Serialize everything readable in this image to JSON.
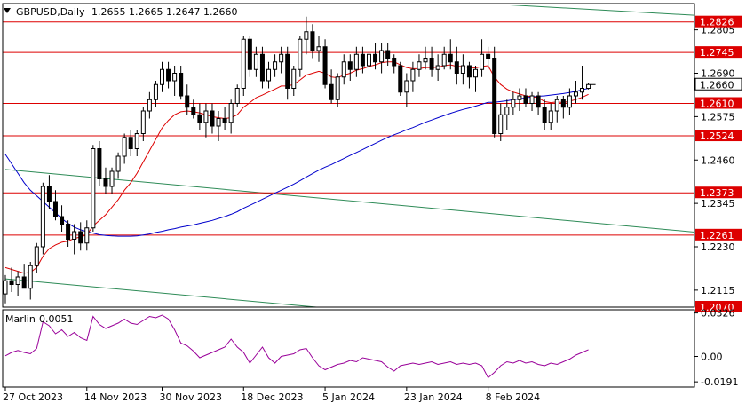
{
  "header": {
    "symbol": "GBPUSD,Daily",
    "open": "1.2655",
    "high": "1.2665",
    "low": "1.2647",
    "close": "1.2660"
  },
  "colors": {
    "background": "#ffffff",
    "candle_up_body": "#ffffff",
    "candle_down_body": "#000000",
    "candle_outline": "#000000",
    "ma_fast": "#dd0000",
    "ma_slow": "#0000cc",
    "trendline": "#2e8b57",
    "horizontal_level": "#dd0000",
    "marlin": "#990099",
    "axis": "#000000"
  },
  "chart_data": [
    {
      "type": "candlestick",
      "title": "GBPUSD,Daily 1.2655 1.2665 1.2647 1.2660",
      "ylim": [
        1.207,
        1.287
      ],
      "y_ticks": [
        "1.2805",
        "1.2690",
        "1.2575",
        "1.2460",
        "1.2345",
        "1.2230",
        "1.2115"
      ],
      "current_price": "1.2660",
      "levels": [
        {
          "value": 1.2826,
          "label": "1.2826"
        },
        {
          "value": 1.2745,
          "label": "1.2745"
        },
        {
          "value": 1.261,
          "label": "1.2610"
        },
        {
          "value": 1.2524,
          "label": "1.2524"
        },
        {
          "value": 1.2373,
          "label": "1.2373"
        },
        {
          "value": 1.2261,
          "label": "1.2261"
        },
        {
          "value": 1.207,
          "label": "1.2070"
        }
      ],
      "x_labels": [
        "27 Oct 2023",
        "14 Nov 2023",
        "30 Nov 2023",
        "18 Dec 2023",
        "5 Jan 2024",
        "23 Jan 2024",
        "8 Feb 2024"
      ],
      "trendlines": [
        {
          "name": "upper-descending-channel",
          "points": [
            [
              0,
              1.2946
            ],
            [
              129,
              1.2826
            ]
          ]
        },
        {
          "name": "middle-descending-line",
          "points": [
            [
              0,
              1.2435
            ],
            [
              129,
              1.224
            ]
          ]
        },
        {
          "name": "lower-descending-line",
          "points": [
            [
              0,
              1.2145
            ],
            [
              129,
              1.195
            ]
          ]
        }
      ],
      "candles": [
        [
          1.2105,
          1.2155,
          1.208,
          1.214
        ],
        [
          1.214,
          1.2175,
          1.211,
          1.213
        ],
        [
          1.213,
          1.2165,
          1.21,
          1.215
        ],
        [
          1.215,
          1.2185,
          1.2125,
          1.212
        ],
        [
          1.212,
          1.219,
          1.209,
          1.218
        ],
        [
          1.218,
          1.224,
          1.216,
          1.223
        ],
        [
          1.223,
          1.24,
          1.221,
          1.239
        ],
        [
          1.239,
          1.242,
          1.233,
          1.235
        ],
        [
          1.235,
          1.238,
          1.23,
          1.231
        ],
        [
          1.231,
          1.234,
          1.227,
          1.229
        ],
        [
          1.229,
          1.23,
          1.223,
          1.225
        ],
        [
          1.225,
          1.229,
          1.221,
          1.227
        ],
        [
          1.227,
          1.2295,
          1.222,
          1.224
        ],
        [
          1.224,
          1.23,
          1.222,
          1.228
        ],
        [
          1.228,
          1.25,
          1.227,
          1.249
        ],
        [
          1.249,
          1.251,
          1.239,
          1.241
        ],
        [
          1.241,
          1.244,
          1.237,
          1.239
        ],
        [
          1.239,
          1.244,
          1.237,
          1.243
        ],
        [
          1.243,
          1.248,
          1.241,
          1.247
        ],
        [
          1.247,
          1.253,
          1.245,
          1.252
        ],
        [
          1.252,
          1.254,
          1.247,
          1.249
        ],
        [
          1.249,
          1.254,
          1.247,
          1.253
        ],
        [
          1.253,
          1.26,
          1.251,
          1.259
        ],
        [
          1.259,
          1.264,
          1.257,
          1.262
        ],
        [
          1.262,
          1.267,
          1.26,
          1.266
        ],
        [
          1.266,
          1.272,
          1.264,
          1.27
        ],
        [
          1.27,
          1.272,
          1.265,
          1.267
        ],
        [
          1.267,
          1.271,
          1.263,
          1.269
        ],
        [
          1.269,
          1.271,
          1.262,
          1.263
        ],
        [
          1.263,
          1.266,
          1.258,
          1.26
        ],
        [
          1.26,
          1.262,
          1.257,
          1.258
        ],
        [
          1.258,
          1.261,
          1.254,
          1.256
        ],
        [
          1.256,
          1.261,
          1.252,
          1.259
        ],
        [
          1.259,
          1.261,
          1.253,
          1.255
        ],
        [
          1.255,
          1.259,
          1.251,
          1.257
        ],
        [
          1.257,
          1.26,
          1.254,
          1.256
        ],
        [
          1.256,
          1.262,
          1.253,
          1.261
        ],
        [
          1.261,
          1.266,
          1.26,
          1.265
        ],
        [
          1.265,
          1.279,
          1.263,
          1.278
        ],
        [
          1.278,
          1.279,
          1.268,
          1.27
        ],
        [
          1.27,
          1.276,
          1.268,
          1.274
        ],
        [
          1.274,
          1.276,
          1.265,
          1.267
        ],
        [
          1.267,
          1.272,
          1.265,
          1.27
        ],
        [
          1.27,
          1.274,
          1.268,
          1.272
        ],
        [
          1.272,
          1.276,
          1.269,
          1.274
        ],
        [
          1.274,
          1.276,
          1.262,
          1.265
        ],
        [
          1.265,
          1.271,
          1.263,
          1.27
        ],
        [
          1.27,
          1.279,
          1.268,
          1.278
        ],
        [
          1.278,
          1.284,
          1.274,
          1.28
        ],
        [
          1.28,
          1.282,
          1.273,
          1.275
        ],
        [
          1.275,
          1.279,
          1.272,
          1.276
        ],
        [
          1.276,
          1.278,
          1.265,
          1.266
        ],
        [
          1.266,
          1.27,
          1.261,
          1.262
        ],
        [
          1.262,
          1.269,
          1.26,
          1.268
        ],
        [
          1.268,
          1.274,
          1.266,
          1.272
        ],
        [
          1.272,
          1.274,
          1.267,
          1.27
        ],
        [
          1.27,
          1.276,
          1.268,
          1.274
        ],
        [
          1.274,
          1.276,
          1.269,
          1.271
        ],
        [
          1.271,
          1.275,
          1.27,
          1.274
        ],
        [
          1.274,
          1.277,
          1.27,
          1.272
        ],
        [
          1.272,
          1.277,
          1.269,
          1.275
        ],
        [
          1.275,
          1.277,
          1.271,
          1.273
        ],
        [
          1.273,
          1.274,
          1.269,
          1.271
        ],
        [
          1.271,
          1.272,
          1.263,
          1.264
        ],
        [
          1.264,
          1.269,
          1.26,
          1.267
        ],
        [
          1.267,
          1.272,
          1.264,
          1.27
        ],
        [
          1.27,
          1.274,
          1.268,
          1.272
        ],
        [
          1.272,
          1.276,
          1.27,
          1.273
        ],
        [
          1.273,
          1.276,
          1.268,
          1.27
        ],
        [
          1.27,
          1.274,
          1.267,
          1.271
        ],
        [
          1.271,
          1.276,
          1.27,
          1.274
        ],
        [
          1.274,
          1.278,
          1.27,
          1.272
        ],
        [
          1.272,
          1.276,
          1.266,
          1.269
        ],
        [
          1.269,
          1.274,
          1.266,
          1.271
        ],
        [
          1.271,
          1.272,
          1.265,
          1.268
        ],
        [
          1.268,
          1.271,
          1.264,
          1.27
        ],
        [
          1.27,
          1.278,
          1.268,
          1.274
        ],
        [
          1.274,
          1.276,
          1.27,
          1.273
        ],
        [
          1.273,
          1.276,
          1.252,
          1.253
        ],
        [
          1.253,
          1.261,
          1.251,
          1.258
        ],
        [
          1.258,
          1.262,
          1.254,
          1.26
        ],
        [
          1.26,
          1.264,
          1.258,
          1.262
        ],
        [
          1.262,
          1.265,
          1.259,
          1.263
        ],
        [
          1.263,
          1.265,
          1.26,
          1.261
        ],
        [
          1.261,
          1.264,
          1.259,
          1.263
        ],
        [
          1.263,
          1.264,
          1.258,
          1.26
        ],
        [
          1.26,
          1.262,
          1.254,
          1.256
        ],
        [
          1.256,
          1.261,
          1.254,
          1.259
        ],
        [
          1.259,
          1.263,
          1.256,
          1.262
        ],
        [
          1.262,
          1.263,
          1.257,
          1.26
        ],
        [
          1.26,
          1.265,
          1.258,
          1.263
        ],
        [
          1.263,
          1.267,
          1.261,
          1.264
        ],
        [
          1.264,
          1.271,
          1.262,
          1.265
        ],
        [
          1.265,
          1.2665,
          1.2647,
          1.266
        ]
      ],
      "ma_fast": [
        1.2175,
        1.217,
        1.2165,
        1.216,
        1.2162,
        1.2175,
        1.2205,
        1.2225,
        1.2235,
        1.2242,
        1.2245,
        1.2252,
        1.2256,
        1.2262,
        1.2285,
        1.23,
        1.2315,
        1.2335,
        1.2355,
        1.238,
        1.24,
        1.2425,
        1.2455,
        1.2485,
        1.2515,
        1.2545,
        1.2565,
        1.258,
        1.2588,
        1.259,
        1.2588,
        1.2585,
        1.258,
        1.2575,
        1.2572,
        1.257,
        1.2572,
        1.258,
        1.26,
        1.2612,
        1.2625,
        1.2632,
        1.264,
        1.2648,
        1.2656,
        1.2656,
        1.266,
        1.2672,
        1.2685,
        1.269,
        1.2695,
        1.269,
        1.268,
        1.2678,
        1.2685,
        1.269,
        1.2698,
        1.2702,
        1.2708,
        1.2712,
        1.2718,
        1.272,
        1.272,
        1.2712,
        1.2705,
        1.2702,
        1.2702,
        1.2705,
        1.2705,
        1.2706,
        1.271,
        1.2712,
        1.2708,
        1.2708,
        1.2705,
        1.2704,
        1.2708,
        1.271,
        1.268,
        1.266,
        1.2648,
        1.264,
        1.2635,
        1.263,
        1.2628,
        1.2625,
        1.2615,
        1.2612,
        1.2614,
        1.2612,
        1.2616,
        1.262,
        1.2626,
        1.2634
      ],
      "ma_slow": [
        1.2475,
        1.245,
        1.2425,
        1.24,
        1.238,
        1.2365,
        1.235,
        1.2335,
        1.232,
        1.2305,
        1.2292,
        1.2282,
        1.2275,
        1.227,
        1.2266,
        1.2262,
        1.226,
        1.2259,
        1.2258,
        1.2258,
        1.2258,
        1.2259,
        1.2261,
        1.2264,
        1.2268,
        1.2271,
        1.2275,
        1.2278,
        1.2282,
        1.2285,
        1.2288,
        1.2292,
        1.2296,
        1.23,
        1.2305,
        1.231,
        1.2316,
        1.2323,
        1.2332,
        1.234,
        1.2348,
        1.2356,
        1.2364,
        1.2372,
        1.238,
        1.2388,
        1.2396,
        1.2405,
        1.2415,
        1.2424,
        1.2433,
        1.2441,
        1.2448,
        1.2456,
        1.2464,
        1.2472,
        1.248,
        1.2488,
        1.2496,
        1.2504,
        1.2512,
        1.252,
        1.2527,
        1.2533,
        1.254,
        1.2546,
        1.2553,
        1.256,
        1.2566,
        1.2572,
        1.2578,
        1.2584,
        1.2589,
        1.2594,
        1.2598,
        1.2603,
        1.2608,
        1.2613,
        1.2613,
        1.2615,
        1.2617,
        1.262,
        1.2622,
        1.2625,
        1.2627,
        1.2629,
        1.263,
        1.2632,
        1.2634,
        1.2636,
        1.2639,
        1.2642,
        1.2646,
        1.265
      ]
    },
    {
      "type": "line",
      "title": "Marlin 0.0051",
      "name": "Marlin",
      "value_label": "0.0051",
      "ylim": [
        -0.023,
        0.035
      ],
      "y_ticks": [
        "0.0326",
        "0.00",
        "-0.0191"
      ],
      "values": [
        0.0005,
        0.003,
        0.0045,
        0.003,
        0.002,
        0.006,
        0.026,
        0.023,
        0.017,
        0.02,
        0.015,
        0.018,
        0.014,
        0.012,
        0.03,
        0.024,
        0.021,
        0.023,
        0.025,
        0.028,
        0.025,
        0.024,
        0.027,
        0.03,
        0.029,
        0.031,
        0.028,
        0.02,
        0.01,
        0.008,
        0.004,
        -0.001,
        0.001,
        0.003,
        0.005,
        0.007,
        0.013,
        0.007,
        0.003,
        -0.005,
        0.001,
        0.007,
        -0.001,
        -0.005,
        0.0,
        0.001,
        0.002,
        0.005,
        0.006,
        -0.001,
        -0.007,
        -0.01,
        -0.008,
        -0.006,
        -0.005,
        -0.003,
        -0.004,
        -0.001,
        -0.002,
        -0.003,
        -0.004,
        -0.008,
        -0.011,
        -0.007,
        -0.006,
        -0.005,
        -0.006,
        -0.005,
        -0.004,
        -0.006,
        -0.005,
        -0.004,
        -0.006,
        -0.005,
        -0.006,
        -0.005,
        -0.007,
        -0.016,
        -0.012,
        -0.007,
        -0.004,
        -0.005,
        -0.003,
        -0.005,
        -0.004,
        -0.006,
        -0.007,
        -0.005,
        -0.006,
        -0.004,
        -0.002,
        0.001,
        0.003,
        0.0051
      ]
    }
  ]
}
